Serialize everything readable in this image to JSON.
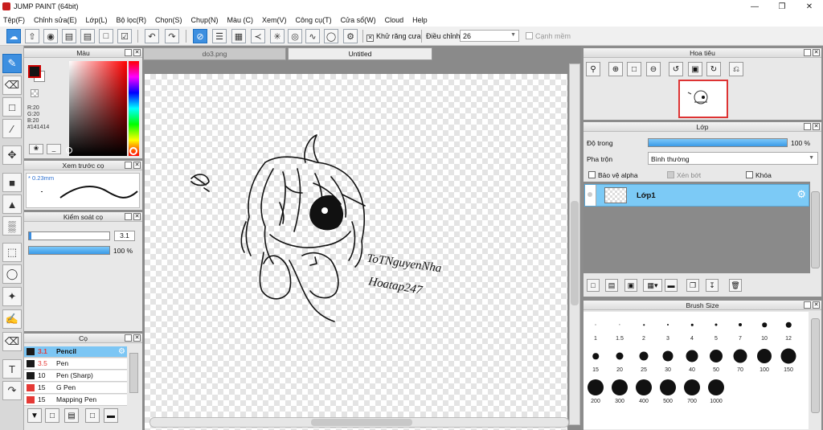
{
  "window": {
    "title": "JUMP PAINT (64bit)"
  },
  "menu": [
    "Tệp(F)",
    "Chỉnh sửa(E)",
    "Lớp(L)",
    "Bộ lọc(R)",
    "Chọn(S)",
    "Chụp(N)",
    "Màu (C)",
    "Xem(V)",
    "Công cụ(T)",
    "Cửa sổ(W)",
    "Cloud",
    "Help"
  ],
  "toolbar": {
    "antialias_label": "Khử răng cưa",
    "adjust_label": "Điều chỉnh",
    "adjust_value": "26",
    "edge_label": "Cạnh mềm"
  },
  "color_panel": {
    "title": "Màu",
    "r": "R:20",
    "g": "G:20",
    "b": "B:20",
    "hex": "#141414",
    "current_color": "#141414"
  },
  "brush_preview": {
    "title": "Xem trước cọ",
    "size": "0.23mm"
  },
  "brush_control": {
    "title": "Kiểm soát cọ",
    "size_value": "3.1",
    "opacity_value": "100 %"
  },
  "brush_list": {
    "title": "Cọ",
    "items": [
      {
        "color": "#1a1a1a",
        "size": "3.1",
        "name": "Pencil"
      },
      {
        "color": "#1a1a1a",
        "size": "3.5",
        "name": "Pen"
      },
      {
        "color": "#1a1a1a",
        "size": "10",
        "name": "Pen (Sharp)"
      },
      {
        "color": "#e53935",
        "size": "15",
        "name": "G Pen"
      },
      {
        "color": "#e53935",
        "size": "15",
        "name": "Mapping Pen"
      }
    ]
  },
  "tabs": [
    {
      "label": "do3.png"
    },
    {
      "label": "Untitled"
    }
  ],
  "canvas": {
    "signature_line1": "ToTNguyenNha",
    "signature_line2": "Hoatap247"
  },
  "navigator": {
    "title": "Hoa tiêu"
  },
  "layers": {
    "title": "Lớp",
    "opacity_label": "Độ trong",
    "opacity_value": "100 %",
    "opacity_fraction": 1.0,
    "blend_label": "Pha trộn",
    "blend_value": "Bình thường",
    "protect_alpha": "Bảo vệ alpha",
    "clipping": "Xén bớt",
    "lock": "Khóa",
    "layer_name": "Lớp1"
  },
  "brush_size": {
    "title": "Brush Size",
    "sizes": [
      "1",
      "1.5",
      "2",
      "3",
      "4",
      "5",
      "7",
      "10",
      "12",
      "15",
      "20",
      "25",
      "30",
      "40",
      "50",
      "70",
      "100",
      "150",
      "200",
      "300",
      "400",
      "500",
      "700",
      "1000"
    ]
  }
}
